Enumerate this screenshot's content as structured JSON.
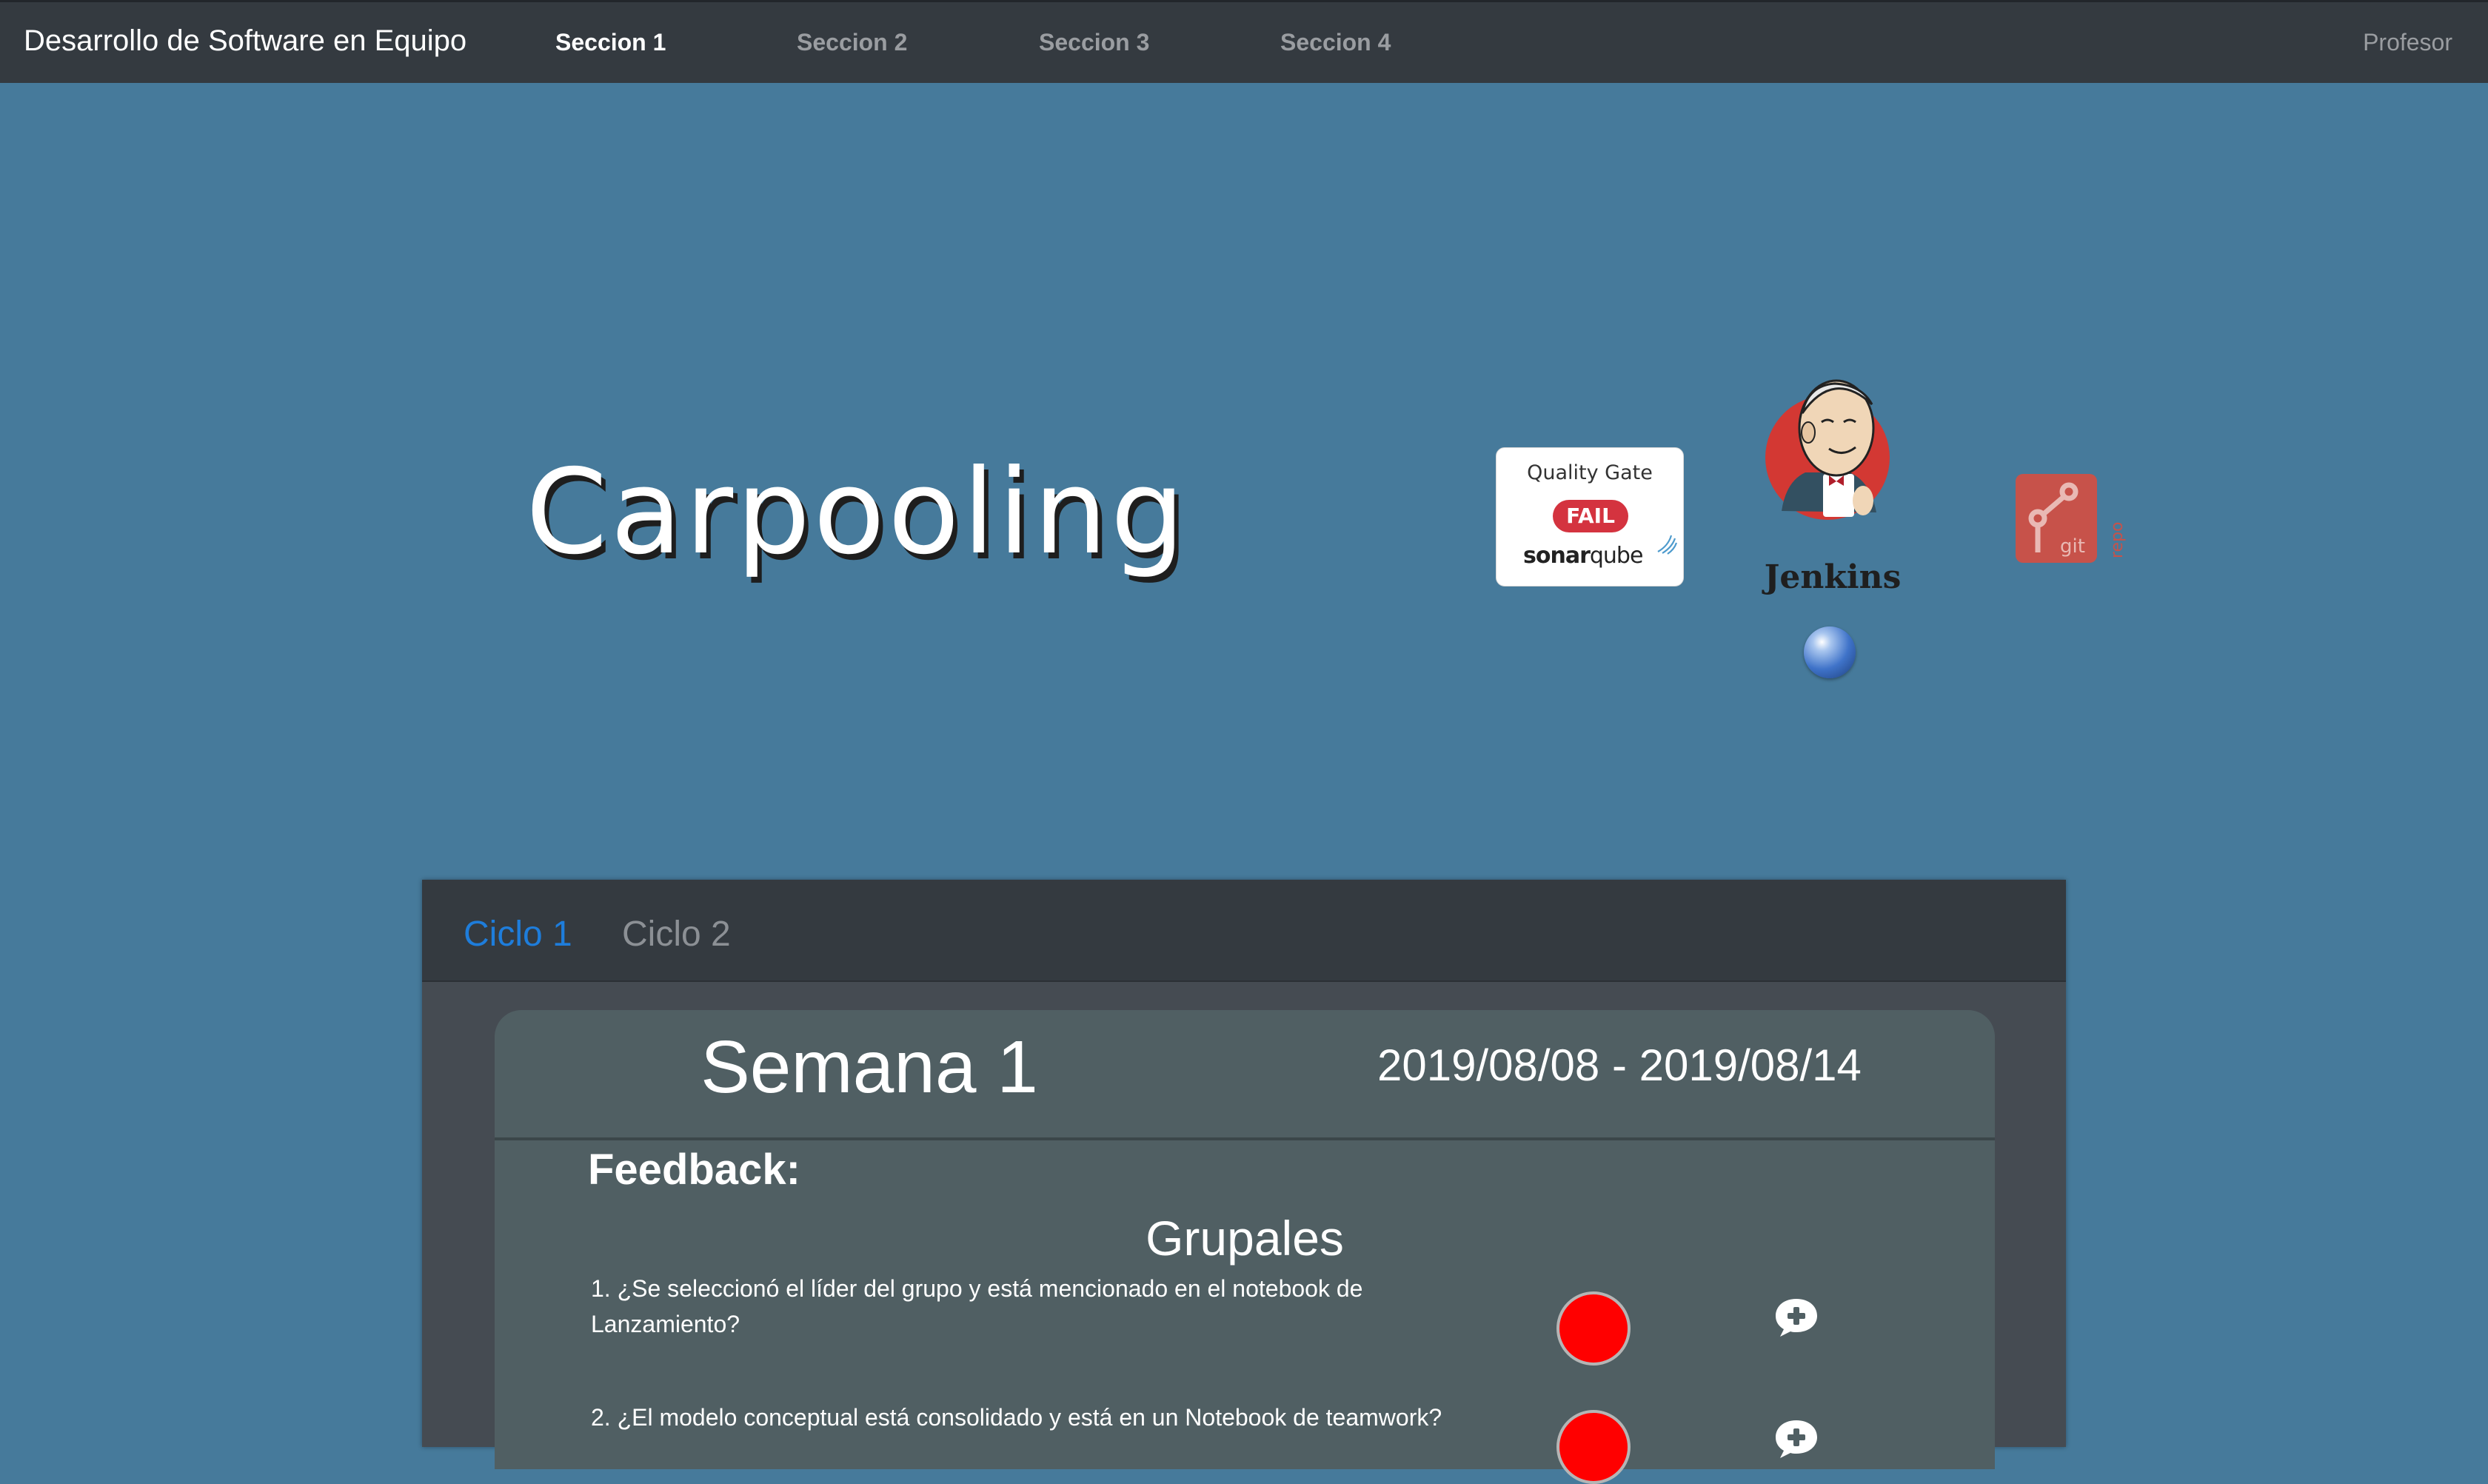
{
  "navbar": {
    "brand": "Desarrollo de Software en Equipo",
    "items": [
      {
        "label": "Seccion 1",
        "active": true
      },
      {
        "label": "Seccion 2",
        "active": false
      },
      {
        "label": "Seccion 3",
        "active": false
      },
      {
        "label": "Seccion 4",
        "active": false
      }
    ],
    "user": "Profesor"
  },
  "project": {
    "title": "Carpooling"
  },
  "badges": {
    "sonar": {
      "label": "Quality Gate",
      "status": "FAIL",
      "brand_prefix": "sonar",
      "brand_suffix": "qube",
      "status_color": "#d4333f"
    },
    "jenkins": {
      "label": "Jenkins",
      "build_status_color": "blue"
    },
    "git": {
      "icon": "git-repo-icon"
    }
  },
  "cycles": {
    "tabs": [
      {
        "label": "Ciclo 1",
        "active": true
      },
      {
        "label": "Ciclo 2",
        "active": false
      }
    ]
  },
  "week": {
    "title": "Semana 1",
    "dates": "2019/08/08 - 2019/08/14",
    "feedback_label": "Feedback:",
    "group_label": "Grupales",
    "questions": [
      {
        "text": "1. ¿Se seleccionó el líder del grupo y está mencionado en el notebook de Lanzamiento?",
        "status_color": "#ff0000"
      },
      {
        "text": "2. ¿El modelo conceptual está consolidado y está en un Notebook de teamwork?",
        "status_color": "#ff0000"
      }
    ]
  },
  "colors": {
    "page_bg": "#467a9b",
    "navbar_bg": "#343a40",
    "active_tab": "#1e7ddb",
    "card_bg": "#505f63"
  }
}
